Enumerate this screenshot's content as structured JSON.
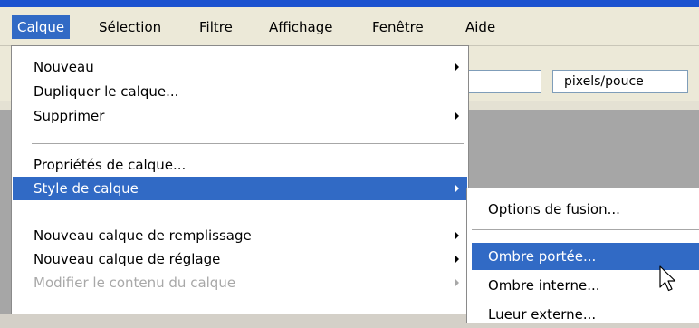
{
  "menubar": {
    "items": [
      {
        "label": "Calque"
      },
      {
        "label": "Sélection"
      },
      {
        "label": "Filtre"
      },
      {
        "label": "Affichage"
      },
      {
        "label": "Fenêtre"
      },
      {
        "label": "Aide"
      }
    ],
    "active": "Calque"
  },
  "options_bar": {
    "unit_select_value": "pixels/pouce"
  },
  "calque_menu": {
    "items": [
      {
        "label": "Nouveau",
        "submenu": true
      },
      {
        "label": "Dupliquer le calque..."
      },
      {
        "label": "Supprimer",
        "submenu": true
      },
      {
        "label": "Propriétés de calque..."
      },
      {
        "label": "Style de calque",
        "submenu": true,
        "highlighted": true
      },
      {
        "label": "Nouveau calque de remplissage",
        "submenu": true
      },
      {
        "label": "Nouveau calque de réglage",
        "submenu": true
      },
      {
        "label": "Modifier le contenu du calque",
        "submenu": true,
        "disabled": true
      }
    ]
  },
  "style_submenu": {
    "items": [
      {
        "label": "Options de fusion..."
      },
      {
        "label": "Ombre portée...",
        "highlighted": true
      },
      {
        "label": "Ombre interne..."
      },
      {
        "label": "Lueur externe..."
      }
    ]
  },
  "colors": {
    "highlight": "#316ac5",
    "menubar_bg": "#ece9d8",
    "title_blue": "#1b52cf"
  },
  "icons": {
    "cursor": "mouse-pointer-icon",
    "submenu": "submenu-arrow-icon"
  }
}
